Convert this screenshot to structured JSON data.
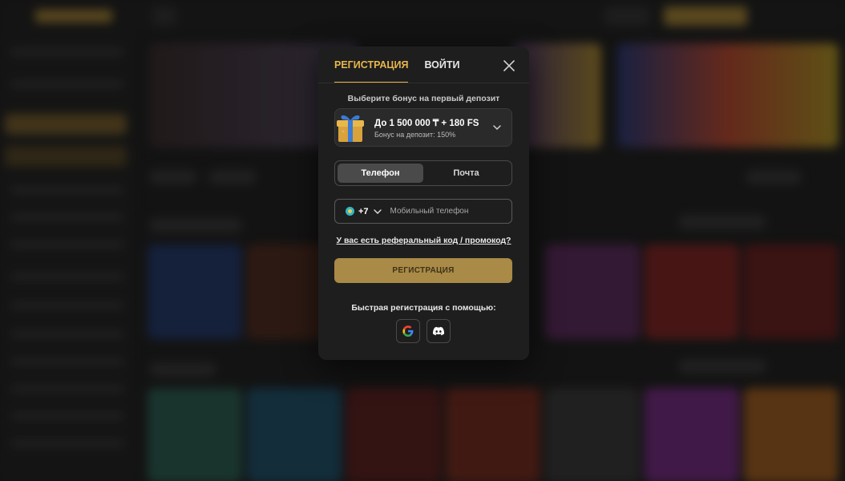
{
  "modal": {
    "tabs": [
      {
        "label": "РЕГИСТРАЦИЯ",
        "active": true
      },
      {
        "label": "ВОЙТИ",
        "active": false
      }
    ],
    "bonus": {
      "caption": "Выберите бонус на первый депозит",
      "title": "До 1 500 000 ₸ + 180 FS",
      "subtitle": "Бонус на депозит: 150%",
      "icon": "gift-box-icon"
    },
    "method_switch": {
      "options": [
        "Телефон",
        "Почта"
      ],
      "selected": "Телефон"
    },
    "phone": {
      "country_code": "+7",
      "flag": "kazakhstan-flag-icon",
      "placeholder": "Мобильный телефон",
      "value": ""
    },
    "promo_link": "У вас есть реферальный код / промокод?",
    "submit_label": "РЕГИСТРАЦИЯ",
    "quick_title": "Быстрая регистрация с помощью:",
    "socials": [
      "google-icon",
      "discord-icon"
    ]
  },
  "colors": {
    "accent": "#e7b64b",
    "button": "#a98a47",
    "modal_bg": "#1e1e1f"
  }
}
